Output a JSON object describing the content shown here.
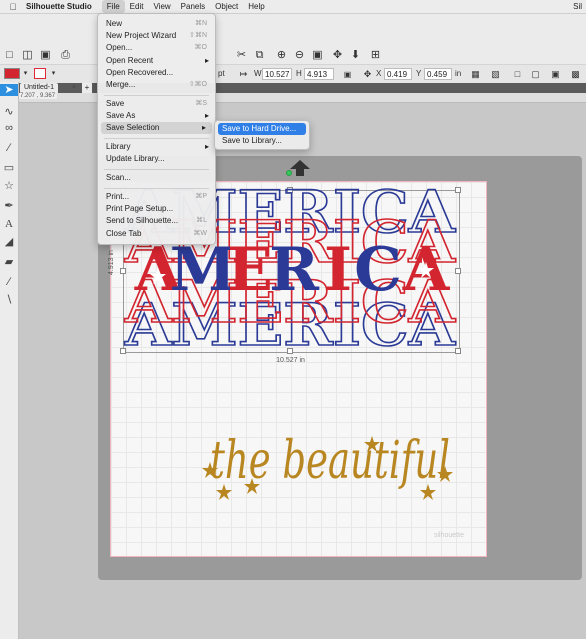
{
  "menubar": {
    "app_name": "Silhouette Studio",
    "items": [
      "File",
      "Edit",
      "View",
      "Panels",
      "Object",
      "Help"
    ],
    "active": "File",
    "right_text": "Sil"
  },
  "toolbar": {
    "width_label": "W",
    "width_value": "10.527",
    "height_label": "H",
    "height_value": "4.913",
    "x_label": "X",
    "x_value": "0.419",
    "y_label": "Y",
    "y_value": "0.459",
    "unit": "in",
    "pt_label": "pt",
    "fill_color": "#d3252f",
    "line_color": "#e02a3a"
  },
  "tabs": {
    "doc_tab": "Untitled-1",
    "close": "×",
    "add": "+"
  },
  "ruler": {
    "coords": "7.207 , 9.367"
  },
  "file_menu": {
    "items": [
      {
        "label": "New",
        "shortcut": "⌘N"
      },
      {
        "label": "New Project Wizard",
        "shortcut": "⇧⌘N"
      },
      {
        "label": "Open...",
        "shortcut": "⌘O"
      },
      {
        "label": "Open Recent",
        "shortcut": "",
        "submenu": true
      },
      {
        "label": "Open Recovered...",
        "shortcut": ""
      },
      {
        "label": "Merge...",
        "shortcut": "⇧⌘O"
      },
      {
        "label": "Save",
        "shortcut": "⌘S"
      },
      {
        "label": "Save As",
        "shortcut": "",
        "submenu": true
      },
      {
        "label": "Save Selection",
        "shortcut": "",
        "submenu": true
      },
      {
        "label": "Library",
        "shortcut": "",
        "submenu": true
      },
      {
        "label": "Update Library...",
        "shortcut": ""
      },
      {
        "label": "Scan...",
        "shortcut": ""
      },
      {
        "label": "Print...",
        "shortcut": "⌘P"
      },
      {
        "label": "Print Page Setup...",
        "shortcut": ""
      },
      {
        "label": "Send to Silhouette...",
        "shortcut": "⌘L"
      },
      {
        "label": "Close Tab",
        "shortcut": "⌘W"
      }
    ],
    "highlighted": "Save Selection"
  },
  "save_selection_submenu": {
    "items": [
      "Save to Hard Drive...",
      "Save to Library..."
    ],
    "highlighted": "Save to Hard Drive..."
  },
  "canvas": {
    "selection_width": "10.527 in",
    "selection_height": "4.913 in",
    "america_text": "AMERICA",
    "beautiful_text": "the beautiful",
    "watermark": "silhouette",
    "colors": {
      "red": "#d3252f",
      "blue": "#2b3a96",
      "gold": "#b98722",
      "mat": "#9a9a9a",
      "mat_border": "#f0b3c0"
    }
  },
  "icons": {
    "apple": "apple-icon",
    "new": "new-document-icon",
    "open": "open-folder-icon",
    "save": "save-icon",
    "print": "print-icon",
    "zoom_in": "zoom-in-icon",
    "zoom_out": "zoom-out-icon",
    "move": "move-icon",
    "add": "add-icon",
    "select": "pointer-icon",
    "edit_points": "edit-points-icon",
    "line": "line-tool-icon",
    "rectangle": "rectangle-tool-icon",
    "star": "star-tool-icon",
    "pen": "pen-tool-icon",
    "text": "text-tool-icon",
    "eraser": "eraser-tool-icon",
    "knife": "knife-tool-icon",
    "eyedropper": "eyedropper-tool-icon"
  }
}
